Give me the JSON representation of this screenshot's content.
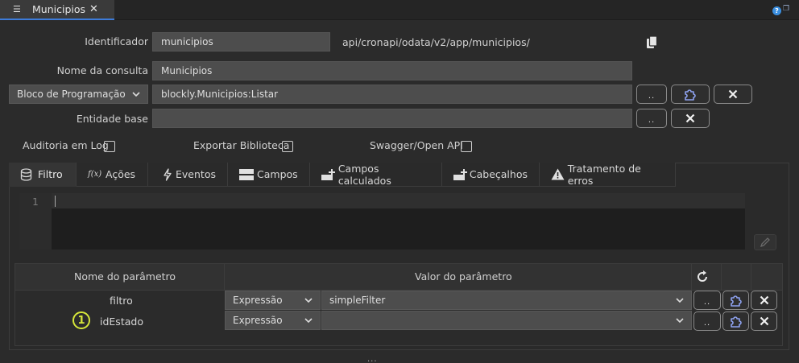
{
  "window": {
    "tab_label": "Municipios",
    "tab_icon": "query-list-icon",
    "close_glyph": "✕"
  },
  "form": {
    "identificador_label": "Identificador",
    "identificador_value": "municipios",
    "api_path": "api/cronapi/odata/v2/app/municipios/",
    "nome_consulta_label": "Nome da consulta",
    "nome_consulta_value": "Municipios",
    "bloco_select_value": "Bloco de Programação",
    "bloco_value": "blockly.Municipios:Listar",
    "entidade_label": "Entidade base",
    "entidade_value": "",
    "ellipsis": "..",
    "auditoria_label": "Auditoria em Log",
    "exportar_label": "Exportar Biblioteca",
    "swagger_label": "Swagger/Open API"
  },
  "tabs": [
    {
      "label": "Filtro",
      "icon": "database-icon"
    },
    {
      "label": "Ações",
      "icon": "function-icon"
    },
    {
      "label": "Eventos",
      "icon": "lightning-icon"
    },
    {
      "label": "Campos",
      "icon": "columns-icon"
    },
    {
      "label": "Campos calculados",
      "icon": "add-field-icon"
    },
    {
      "label": "Cabeçalhos",
      "icon": "add-header-icon"
    },
    {
      "label": "Tratamento de erros",
      "icon": "warning-icon"
    }
  ],
  "editor": {
    "line_number": "1"
  },
  "params": {
    "col_name": "Nome do parâmetro",
    "col_value": "Valor do parâmetro",
    "rows": [
      {
        "name": "filtro",
        "type": "Expressão",
        "value": "simpleFilter"
      },
      {
        "name": "idEstado",
        "type": "Expressão",
        "value": ""
      }
    ],
    "marker": "1"
  },
  "footer": {
    "handle": "..."
  },
  "colors": {
    "accent": "#3d7bd9",
    "puzzle": "#8ea2f0",
    "marker": "#d6e63a"
  }
}
